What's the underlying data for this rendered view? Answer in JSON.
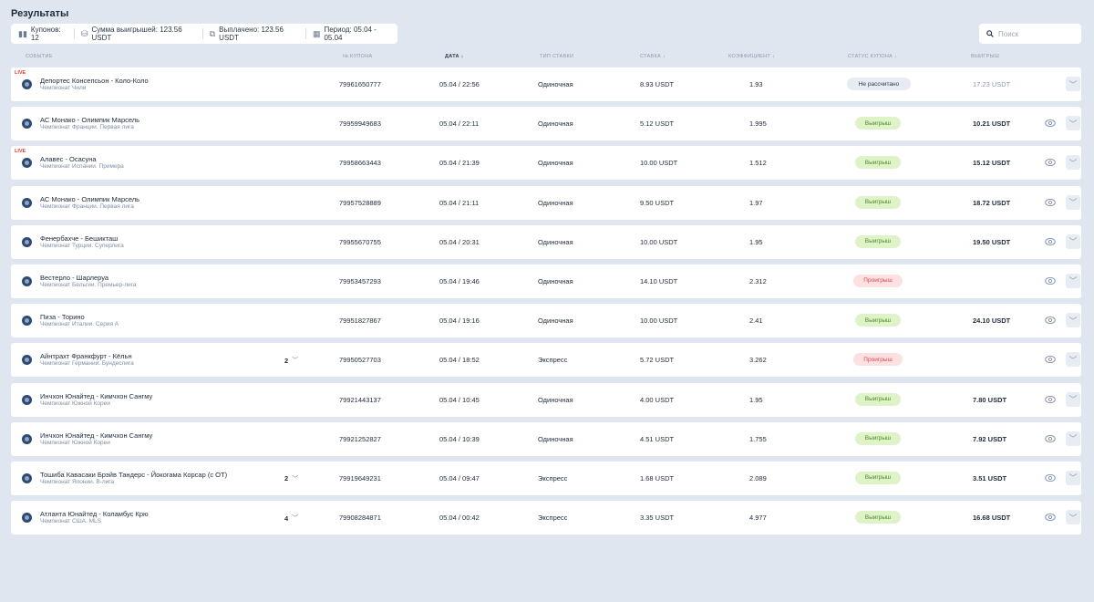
{
  "title": "Результаты",
  "summary": {
    "coupons": "Купонов: 12",
    "winnings_sum": "Сумма выигрышей: 123.56 USDT",
    "paid": "Выплачено: 123.56 USDT",
    "period": "Период: 05.04 - 05.04"
  },
  "search": {
    "placeholder": "Поиск"
  },
  "columns": {
    "event": "Событие",
    "coupon_no": "№ купона",
    "date": "Дата",
    "bet_type": "Тип ставки",
    "stake": "Ставка",
    "coef": "Коэффициент",
    "status": "Статус купона",
    "winnings": "Выигрыш"
  },
  "rows": [
    {
      "live": "LIVE",
      "event": "Депортес Консепсьон - Коло-Коло",
      "league": "Чемпионат Чили",
      "count": "",
      "number": "79961650777",
      "date": "05.04 / 22:56",
      "type": "Одиночная",
      "stake": "8.93 USDT",
      "coef": "1.93",
      "status": "Не рассчитано",
      "status_kind": "pending",
      "winnings": "17.23 USDT",
      "win_grey": true,
      "eye": false
    },
    {
      "live": "",
      "event": "АС Монако - Олимпик Марсель",
      "league": "Чемпионат Франции. Первая лига",
      "count": "",
      "number": "79959949683",
      "date": "05.04 / 22:11",
      "type": "Одиночная",
      "stake": "5.12 USDT",
      "coef": "1.995",
      "status": "Выигрыш",
      "status_kind": "win",
      "winnings": "10.21 USDT",
      "win_grey": false,
      "eye": true
    },
    {
      "live": "LIVE",
      "event": "Алавес - Осасуна",
      "league": "Чемпионат Испании. Примера",
      "count": "",
      "number": "79958663443",
      "date": "05.04 / 21:39",
      "type": "Одиночная",
      "stake": "10.00 USDT",
      "coef": "1.512",
      "status": "Выигрыш",
      "status_kind": "win",
      "winnings": "15.12 USDT",
      "win_grey": false,
      "eye": true
    },
    {
      "live": "",
      "event": "АС Монако - Олимпик Марсель",
      "league": "Чемпионат Франции. Первая лига",
      "count": "",
      "number": "79957528889",
      "date": "05.04 / 21:11",
      "type": "Одиночная",
      "stake": "9.50 USDT",
      "coef": "1.97",
      "status": "Выигрыш",
      "status_kind": "win",
      "winnings": "18.72 USDT",
      "win_grey": false,
      "eye": true
    },
    {
      "live": "",
      "event": "Фенербахче - Бешикташ",
      "league": "Чемпионат Турции. Суперлига",
      "count": "",
      "number": "79955670755",
      "date": "05.04 / 20:31",
      "type": "Одиночная",
      "stake": "10.00 USDT",
      "coef": "1.95",
      "status": "Выигрыш",
      "status_kind": "win",
      "winnings": "19.50 USDT",
      "win_grey": false,
      "eye": true
    },
    {
      "live": "",
      "event": "Вестерло - Шарлеруа",
      "league": "Чемпионат Бельгии. Премьер-лига",
      "count": "",
      "number": "79953457293",
      "date": "05.04 / 19:46",
      "type": "Одиночная",
      "stake": "14.10 USDT",
      "coef": "2.312",
      "status": "Проигрыш",
      "status_kind": "lose",
      "winnings": "",
      "win_grey": false,
      "eye": true
    },
    {
      "live": "",
      "event": "Пиза - Торино",
      "league": "Чемпионат Италии. Серия А",
      "count": "",
      "number": "79951827867",
      "date": "05.04 / 19:16",
      "type": "Одиночная",
      "stake": "10.00 USDT",
      "coef": "2.41",
      "status": "Выигрыш",
      "status_kind": "win",
      "winnings": "24.10 USDT",
      "win_grey": false,
      "eye": true
    },
    {
      "live": "",
      "event": "Айнтрахт Франкфурт - Кёльн",
      "league": "Чемпионат Германии. Бундеслига",
      "count": "2",
      "number": "79950527703",
      "date": "05.04 / 18:52",
      "type": "Экспресс",
      "stake": "5.72 USDT",
      "coef": "3.262",
      "status": "Проигрыш",
      "status_kind": "lose",
      "winnings": "",
      "win_grey": false,
      "eye": true
    },
    {
      "live": "",
      "event": "Инчхон Юнайтед - Кимчхон Сангму",
      "league": "Чемпионат Южной Кореи",
      "count": "",
      "number": "79921443137",
      "date": "05.04 / 10:45",
      "type": "Одиночная",
      "stake": "4.00 USDT",
      "coef": "1.95",
      "status": "Выигрыш",
      "status_kind": "win",
      "winnings": "7.80 USDT",
      "win_grey": false,
      "eye": true
    },
    {
      "live": "",
      "event": "Инчхон Юнайтед - Кимчхон Сангму",
      "league": "Чемпионат Южной Кореи",
      "count": "",
      "number": "79921252827",
      "date": "05.04 / 10:39",
      "type": "Одиночная",
      "stake": "4.51 USDT",
      "coef": "1.755",
      "status": "Выигрыш",
      "status_kind": "win",
      "winnings": "7.92 USDT",
      "win_grey": false,
      "eye": true
    },
    {
      "live": "",
      "event": "Тошиба Кавасаки Брэйв Тандерс - Йокогама Корсар (с ОТ)",
      "league": "Чемпионат Японии. B-лига",
      "count": "2",
      "number": "79919649231",
      "date": "05.04 / 09:47",
      "type": "Экспресс",
      "stake": "1.68 USDT",
      "coef": "2.089",
      "status": "Выигрыш",
      "status_kind": "win",
      "winnings": "3.51 USDT",
      "win_grey": false,
      "eye": true
    },
    {
      "live": "",
      "event": "Атланта Юнайтед - Коламбус Крю",
      "league": "Чемпионат США. MLS",
      "count": "4",
      "number": "79908284871",
      "date": "05.04 / 00:42",
      "type": "Экспресс",
      "stake": "3.35 USDT",
      "coef": "4.977",
      "status": "Выигрыш",
      "status_kind": "win",
      "winnings": "16.68 USDT",
      "win_grey": false,
      "eye": true
    }
  ]
}
